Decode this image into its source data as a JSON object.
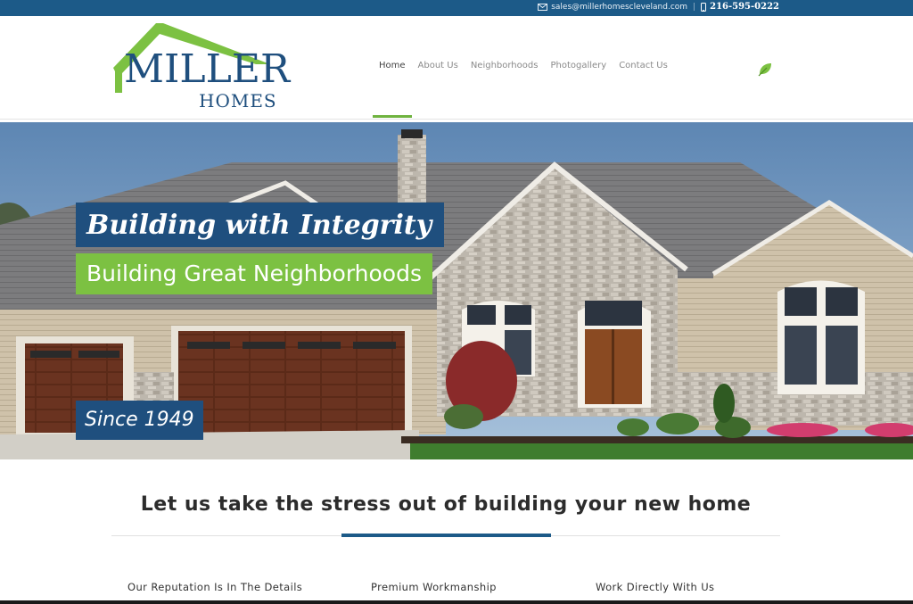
{
  "topbar": {
    "email": "sales@millerhomescleveland.com",
    "separator": "|",
    "phone": "216-595-0222"
  },
  "logo": {
    "line1": "MILLER",
    "line2": "HOMES",
    "roof_color": "#7cc142",
    "text_color": "#1f4f7e"
  },
  "nav": {
    "items": [
      {
        "label": "Home",
        "active": true
      },
      {
        "label": "About Us",
        "active": false
      },
      {
        "label": "Neighborhoods",
        "active": false
      },
      {
        "label": "Photogallery",
        "active": false
      },
      {
        "label": "Contact Us",
        "active": false
      }
    ],
    "accent_color": "#6fb33f",
    "extra_icon": "leaf-icon"
  },
  "hero": {
    "tagline_1": "Building with Integrity",
    "tagline_2": "Building Great Neighborhoods",
    "tagline_3": "Since 1949",
    "navy": "#1f4f7e",
    "green": "#7cc142"
  },
  "main": {
    "headline": "Let us take the stress out of building your new home",
    "features": [
      "Our Reputation Is In The Details",
      "Premium Workmanship",
      "Work Directly With Us"
    ]
  },
  "icons": [
    "mail-icon",
    "phone-icon",
    "leaf-icon"
  ]
}
